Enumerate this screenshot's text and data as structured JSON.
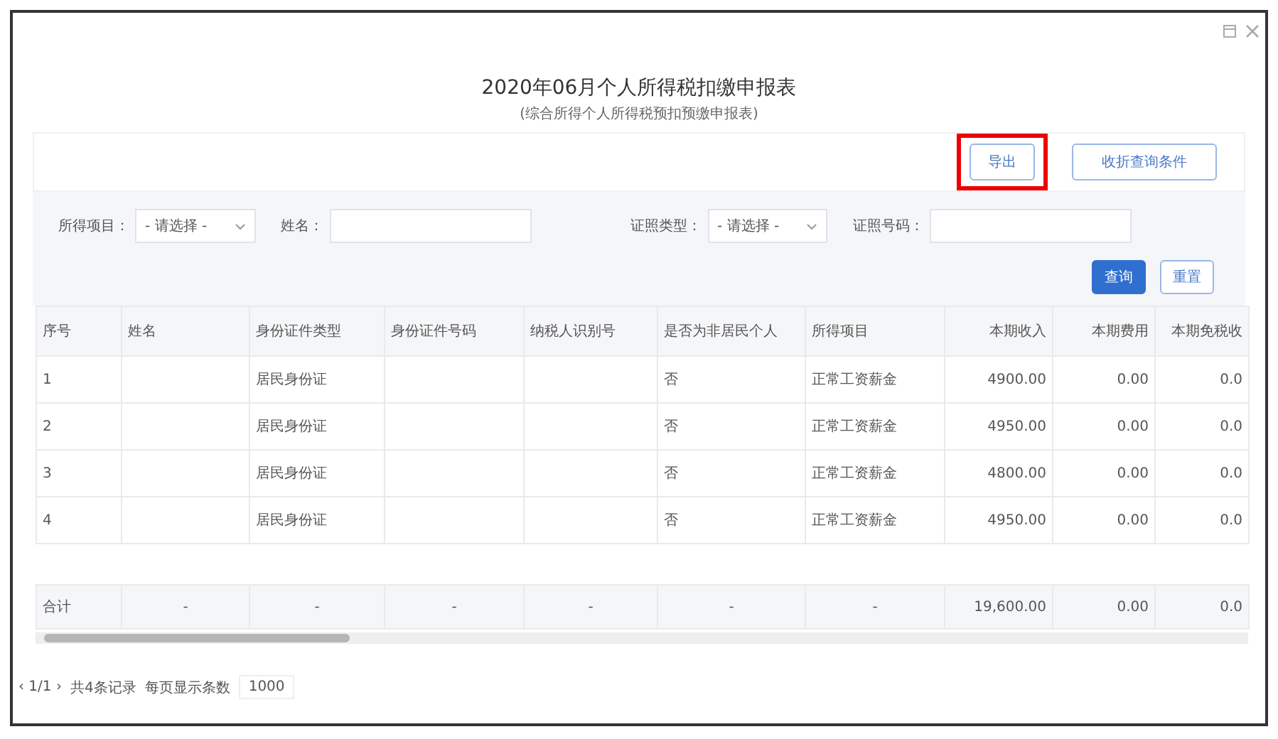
{
  "dialog": {
    "title": "2020年06月个人所得税扣缴申报表",
    "subtitle": "(综合所得个人所得税预扣预缴申报表)"
  },
  "toolbar": [
    {
      "kind": "export",
      "label": "导出",
      "highlighted": true
    },
    {
      "kind": "toggle",
      "label": "收折查询条件",
      "highlighted": false
    }
  ],
  "filters": [
    {
      "kind": "select",
      "label": "所得项目：",
      "value": "- 请选择 -"
    },
    {
      "kind": "input",
      "label": "姓名："
    },
    {
      "kind": "select",
      "label": "证照类型：",
      "value": "- 请选择 -"
    },
    {
      "kind": "input",
      "label": "证照号码："
    }
  ],
  "actions": [
    {
      "label": "查询",
      "primary": true
    },
    {
      "label": "重置",
      "primary": false
    }
  ],
  "table": {
    "columns": [
      {
        "label": "序号",
        "kind": "text"
      },
      {
        "label": "姓名",
        "kind": "text"
      },
      {
        "label": "身份证件类型",
        "kind": "text"
      },
      {
        "label": "身份证件号码",
        "kind": "text"
      },
      {
        "label": "纳税人识别号",
        "kind": "text"
      },
      {
        "label": "是否为非居民个人",
        "kind": "text"
      },
      {
        "label": "所得项目",
        "kind": "text"
      },
      {
        "label": "本期收入",
        "kind": "amount"
      },
      {
        "label": "本期费用",
        "kind": "amount"
      },
      {
        "label": "本期免税收",
        "kind": "amount"
      }
    ],
    "rows": [
      [
        "1",
        "",
        "居民身份证",
        "",
        "",
        "否",
        "正常工资薪金",
        "4900.00",
        "0.00",
        "0.0"
      ],
      [
        "2",
        "",
        "居民身份证",
        "",
        "",
        "否",
        "正常工资薪金",
        "4950.00",
        "0.00",
        "0.0"
      ],
      [
        "3",
        "",
        "居民身份证",
        "",
        "",
        "否",
        "正常工资薪金",
        "4800.00",
        "0.00",
        "0.0"
      ],
      [
        "4",
        "",
        "居民身份证",
        "",
        "",
        "否",
        "正常工资薪金",
        "4950.00",
        "0.00",
        "0.0"
      ]
    ],
    "total": [
      "合计",
      "-",
      "-",
      "-",
      "-",
      "-",
      "-",
      "19,600.00",
      "0.00",
      "0.0"
    ]
  },
  "pager": {
    "pages": "‹ 1/1 ›",
    "records": "共4条记录",
    "per_page_label": "每页显示条数",
    "per_page": "1000"
  }
}
